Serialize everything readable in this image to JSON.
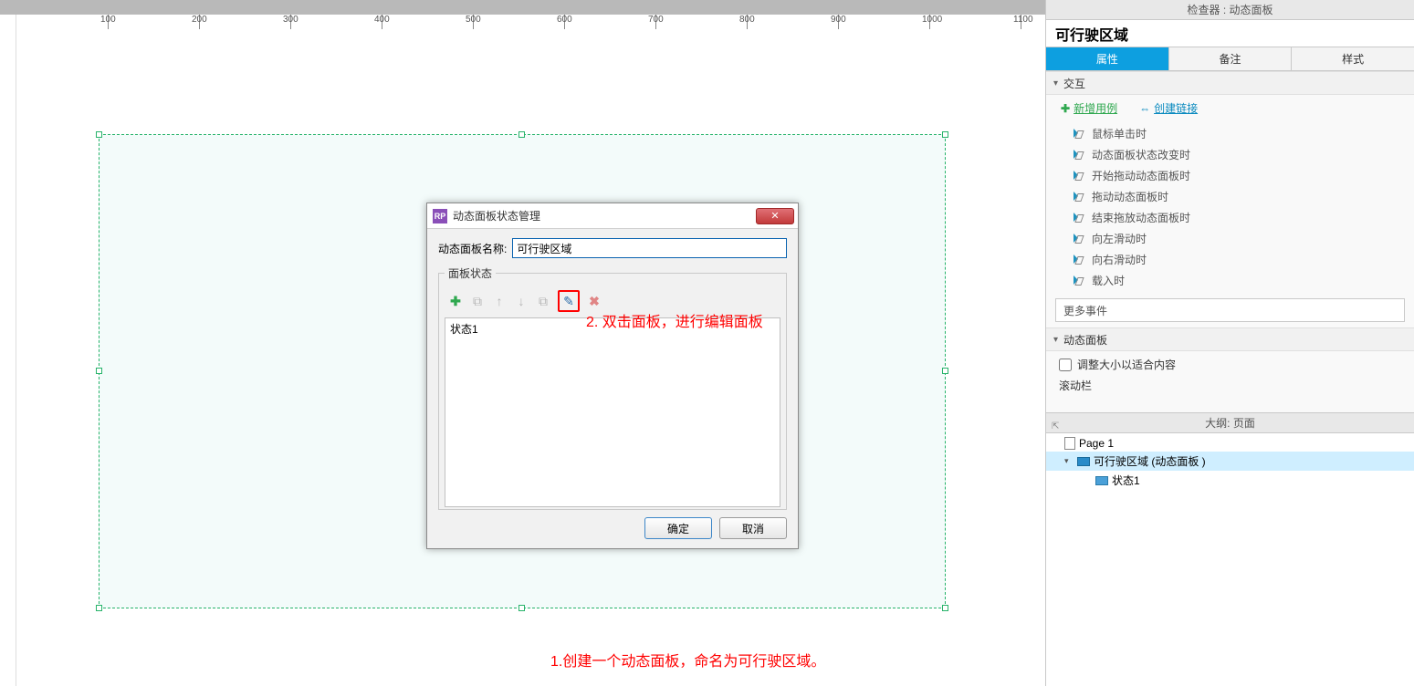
{
  "ruler_ticks": [
    100,
    200,
    300,
    400,
    500,
    600,
    700,
    800,
    900,
    1000,
    1100
  ],
  "annotations": {
    "step2": "2. 双击面板，进行编辑面板",
    "step1": "1.创建一个动态面板，命名为可行驶区域。"
  },
  "dialog": {
    "title": "动态面板状态管理",
    "close_x": "✕",
    "name_label": "动态面板名称:",
    "name_value": "可行驶区域",
    "states_legend": "面板状态",
    "state_items": [
      "状态1"
    ],
    "ok": "确定",
    "cancel": "取消"
  },
  "inspector": {
    "title": "检查器 : 动态面板",
    "object_name": "可行驶区域",
    "tabs": {
      "props": "属性",
      "notes": "备注",
      "style": "样式"
    },
    "interactions": {
      "section": "交互",
      "add_case": "新增用例",
      "create_link": "创建链接",
      "events": [
        "鼠标单击时",
        "动态面板状态改变时",
        "开始拖动动态面板时",
        "拖动动态面板时",
        "结束拖放动态面板时",
        "向左滑动时",
        "向右滑动时",
        "载入时"
      ],
      "more_events": "更多事件"
    },
    "dyn_section": "动态面板",
    "fit_label": "调整大小以适合内容",
    "scrollbar_label": "滚动栏"
  },
  "outline": {
    "title": "大纲: 页面",
    "page": "Page 1",
    "node": "可行驶区域 (动态面板 )",
    "state": "状态1"
  }
}
